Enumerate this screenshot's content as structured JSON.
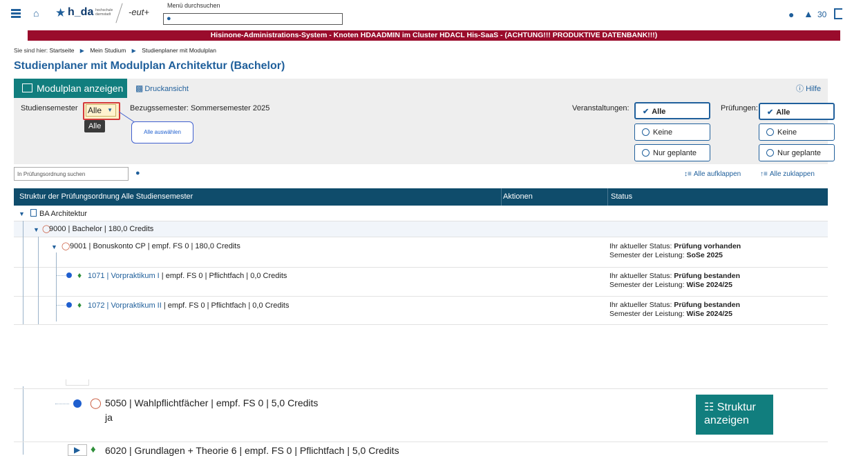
{
  "header": {
    "logo_text": "h_da",
    "logo_sub": "hochschule darmstadt",
    "eut_logo": "-eut+",
    "menu_search_label": "Menü durchsuchen",
    "notification_count": "30"
  },
  "banner": "Hisinone-Administrations-System - Knoten HDAADMIN im Cluster HDACL His-SaaS - (ACHTUNG!!! PRODUKTIVE DATENBANK!!!)",
  "breadcrumb": {
    "prefix": "Sie sind hier:",
    "items": [
      "Startseite",
      "Mein Studium",
      "Studienplaner mit Modulplan"
    ]
  },
  "page_title": "Studienplaner mit Modulplan Architektur (Bachelor)",
  "toolbar": {
    "modulplan_label": "Modulplan anzeigen",
    "druck_label": "Druckansicht",
    "hilfe_label": "Hilfe"
  },
  "filters": {
    "studiensemester_label": "Studiensemester",
    "studiensemester_value": "Alle",
    "tooltip": "Alle",
    "callout": "Alle auswählen",
    "bezugssemester": "Bezugssemester: Sommersemester 2025",
    "veranstaltungen_label": "Veranstaltungen:",
    "pruefungen_label": "Prüfungen:",
    "options": [
      "Alle",
      "Keine",
      "Nur geplante"
    ]
  },
  "search": {
    "placeholder": "In Prüfungsordnung suchen",
    "expand_all": "Alle aufklappen",
    "collapse_all": "Alle zuklappen"
  },
  "table": {
    "headers": [
      "Struktur der Prüfungsordnung Alle Studiensemester",
      "Aktionen",
      "Status"
    ],
    "rows": [
      {
        "label": "BA Architektur"
      },
      {
        "label": "9000 | Bachelor  | 180,0 Credits"
      },
      {
        "label": "9001 | Bonuskonto CP  |  empf. FS 0  | 180,0 Credits",
        "status_prefix": "Ihr aktueller Status:",
        "status": "Prüfung vorhanden",
        "sem_prefix": "Semester der Leistung:",
        "sem": "SoSe 2025"
      },
      {
        "link": "1071 | Vorpraktikum I",
        "label": "  |  empf. FS 0  |  Pflichtfach | 0,0 Credits",
        "status_prefix": "Ihr aktueller Status:",
        "status": "Prüfung bestanden",
        "sem_prefix": "Semester der Leistung:",
        "sem": "WiSe 2024/25"
      },
      {
        "link": "1072 | Vorpraktikum II",
        "label": "  |  empf. FS 0  |  Pflichtfach | 0,0 Credits",
        "status_prefix": "Ihr aktueller Status:",
        "status": "Prüfung bestanden",
        "sem_prefix": "Semester der Leistung:",
        "sem": "WiSe 2024/25"
      }
    ]
  },
  "lower": {
    "row1_label": "5050 | Wahlpflichtfächer  |  empf. FS 0  | 5,0 Credits",
    "row1_sub": "ja",
    "struktur_btn": "Struktur anzeigen",
    "row2_label": "6020 | Grundlagen + Theorie 6  |  empf. FS 0  |  Pflichtfach | 5,0 Credits"
  }
}
